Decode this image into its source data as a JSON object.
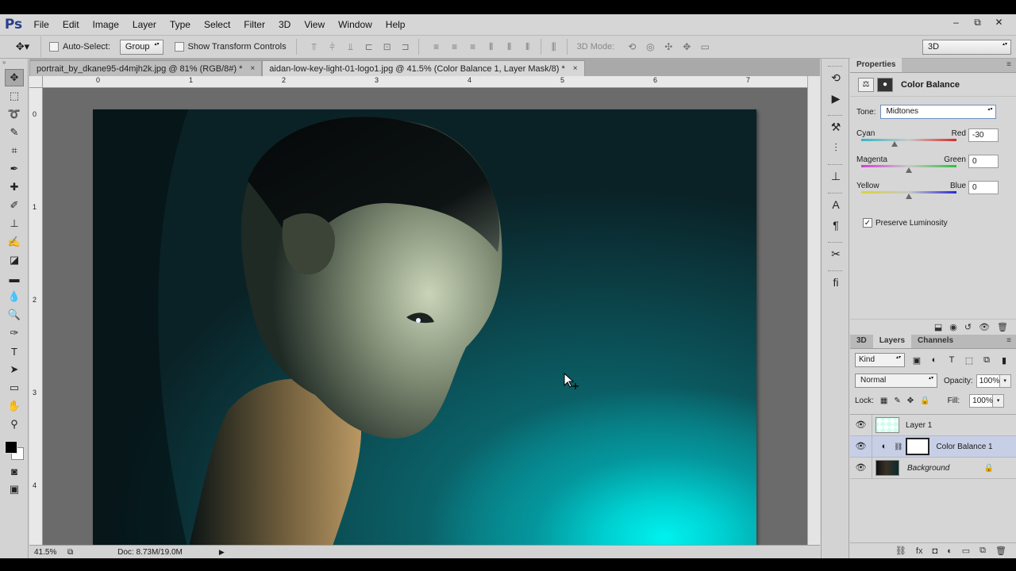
{
  "menu": {
    "logo": "Ps",
    "items": [
      "File",
      "Edit",
      "Image",
      "Layer",
      "Type",
      "Select",
      "Filter",
      "3D",
      "View",
      "Window",
      "Help"
    ],
    "win_minimize": "‒",
    "win_restore": "⧉",
    "win_close": "✕"
  },
  "options": {
    "auto_select_label": "Auto-Select:",
    "auto_select_value": "Group",
    "show_transform_label": "Show Transform Controls",
    "mode3d_label": "3D Mode:",
    "workspace": "3D"
  },
  "tabs": [
    {
      "label": "portrait_by_dkane95-d4mjh2k.jpg @ 81% (RGB/8#) *",
      "close": "×"
    },
    {
      "label": "aidan-low-key-light-01-logo1.jpg @ 41.5% (Color Balance 1, Layer Mask/8) *",
      "close": "×"
    }
  ],
  "ruler": {
    "h_numbers": [
      "0",
      "1",
      "2",
      "3",
      "4",
      "5",
      "6",
      "7"
    ],
    "v_numbers": [
      "0",
      "1",
      "2",
      "3",
      "4"
    ]
  },
  "status": {
    "zoom": "41.5%",
    "doc": "Doc: 8.73M/19.0M"
  },
  "properties": {
    "tab": "Properties",
    "title": "Color Balance",
    "tone_label": "Tone:",
    "tone_value": "Midtones",
    "sliders": [
      {
        "left": "Cyan",
        "right": "Red",
        "value": "-30",
        "level": -30,
        "colors": [
          "#2fb7c6",
          "#d52a2a"
        ]
      },
      {
        "left": "Magenta",
        "right": "Green",
        "value": "0",
        "level": 0,
        "colors": [
          "#d53ad5",
          "#2fbf3a"
        ]
      },
      {
        "left": "Yellow",
        "right": "Blue",
        "value": "0",
        "level": 0,
        "colors": [
          "#dcd236",
          "#2a2ad5"
        ]
      }
    ],
    "preserve_label": "Preserve Luminosity",
    "preserve_checked": true
  },
  "layers_panel": {
    "tabs": [
      "3D",
      "Layers",
      "Channels"
    ],
    "kind": "Kind",
    "blend_mode": "Normal",
    "opacity_label": "Opacity:",
    "opacity_value": "100%",
    "lock_label": "Lock:",
    "fill_label": "Fill:",
    "fill_value": "100%",
    "layers": [
      {
        "name": "Layer 1"
      },
      {
        "name": "Color Balance 1"
      },
      {
        "name": "Background"
      }
    ]
  }
}
